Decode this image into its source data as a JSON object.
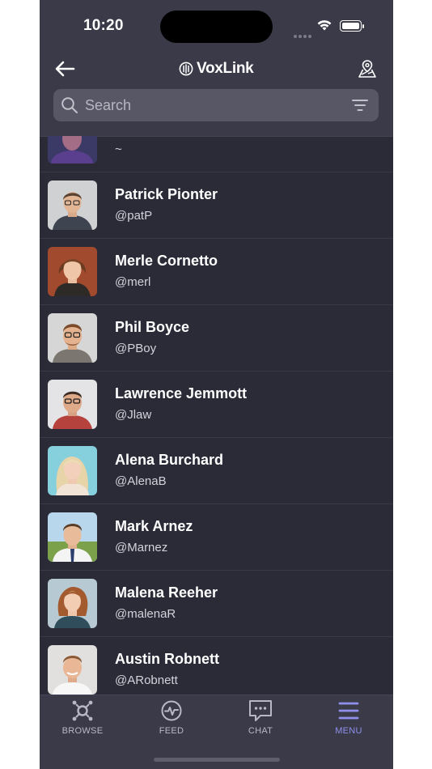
{
  "status": {
    "time": "10:20"
  },
  "header": {
    "brand": "VoxLink"
  },
  "search": {
    "placeholder": "Search",
    "value": ""
  },
  "users": [
    {
      "name": "",
      "handle": "~"
    },
    {
      "name": "Patrick Pionter",
      "handle": "@patP"
    },
    {
      "name": "Merle Cornetto",
      "handle": "@merl"
    },
    {
      "name": "Phil Boyce",
      "handle": "@PBoy"
    },
    {
      "name": "Lawrence Jemmott",
      "handle": "@Jlaw"
    },
    {
      "name": "Alena Burchard",
      "handle": "@AlenaB"
    },
    {
      "name": "Mark Arnez",
      "handle": "@Marnez"
    },
    {
      "name": "Malena Reeher",
      "handle": "@malenaR"
    },
    {
      "name": "Austin Robnett",
      "handle": "@ARobnett"
    }
  ],
  "tabs": [
    {
      "label": "BROWSE",
      "icon": "browse-icon"
    },
    {
      "label": "FEED",
      "icon": "feed-icon"
    },
    {
      "label": "CHAT",
      "icon": "chat-icon"
    },
    {
      "label": "MENU",
      "icon": "menu-icon",
      "active": true
    }
  ],
  "colors": {
    "background": "#2b2b38",
    "header": "#3a3a48",
    "accent": "#9090ec"
  }
}
